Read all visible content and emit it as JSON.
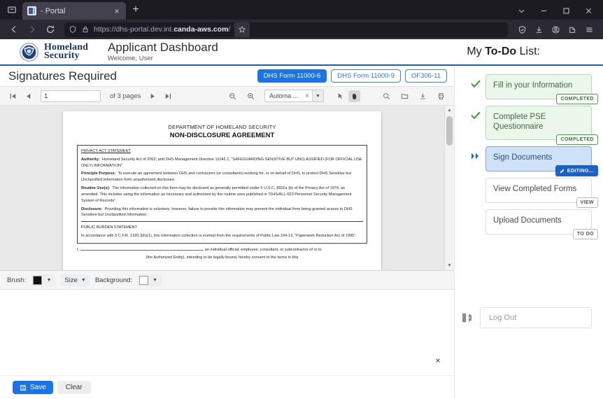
{
  "browser": {
    "tab_title": "- Portal",
    "url_display_prefix": "https://dhs-portal.dev.int.",
    "url_display_domain": "canda-aws.com",
    "url_display_suffix": "/",
    "new_tab_label": "+",
    "close_tab_label": "×"
  },
  "header": {
    "agency_line1": "Homeland",
    "agency_line2": "Security",
    "app_title": "Applicant Dashboard",
    "welcome": "Welcome, User",
    "todo_heading_pre": "My ",
    "todo_heading_bold": "To-Do",
    "todo_heading_post": " List:"
  },
  "signatures": {
    "title": "Signatures Required",
    "form_tabs": [
      {
        "label": "DHS Form 11000-6",
        "active": true
      },
      {
        "label": "DHS Form 11000-9",
        "active": false
      },
      {
        "label": "OF306-11",
        "active": false
      }
    ]
  },
  "pdf_toolbar": {
    "page_value": "1",
    "page_total_label": "of 3 pages",
    "zoom_value": "Automa ...",
    "zoom_clear": "×",
    "zoom_caret": "▼",
    "icons": {
      "first_page": "first-page-icon",
      "prev_page": "prev-page-icon",
      "next_page": "next-page-icon",
      "last_page": "last-page-icon",
      "zoom_out": "zoom-out-icon",
      "zoom_in": "zoom-in-icon",
      "select_tool": "cursor-select-icon",
      "pan_tool": "hand-pan-icon",
      "find": "search-icon",
      "open_file": "open-file-icon",
      "download": "download-icon",
      "print": "print-icon"
    }
  },
  "document": {
    "agency": "DEPARTMENT OF HOMELAND SECURITY",
    "title": "NON-DISCLOSURE AGREEMENT",
    "privacy_heading": "PRIVACY ACT STATEMENT",
    "authority_label": "Authority:",
    "authority_text": "Homeland Security Act of 2002; and DHS Management Directive 11042.1, “SAFEGUARDING SENSITIVE BUT UNCLASSIFIED (FOR OFFICIAL USE ONLY) INFORMATION”.",
    "principle_label": "Principle Purpose:",
    "principle_text": "To execute an agreement between DHS and contractors (or consultants) working for, or on behalf of DHS, to protect DHS Sensitive but Unclassified Information from unauthorized disclosure.",
    "routine_label": "Routine Use(s):",
    "routine_text": "The information collected on this form may be disclosed as generally permitted under 5 U.S.C. §552a (b) of the Privacy Act of 1974, as amended. This includes using the information as necessary and authorized by the routine uses published in “DHS/ALL-023 Personnel Security Management System of Records”.",
    "disclosure_label": "Disclosure:",
    "disclosure_text": "Providing this information is voluntary; however, failure to provide this information may prevent the individual from being granted access to DHS Sensitive but Unclassified Information.",
    "burden_heading": "PUBLIC BURDEN STATEMENT",
    "burden_text": "In accordance with 5 C.F.R. 1320.3(h)(1), this information collection is exempt from the requirements of Public Law 104-13, “Paperwork Reduction Act of 1995”.",
    "consent_start": "I,",
    "consent_mid": ", an individual official, employee, consultant, or subcontractor of or to",
    "consent_line2": "(the Authorized Entity), intending to be legally bound, hereby consent to the terms in this"
  },
  "signature_tools": {
    "brush_label": "Brush:",
    "brush_color": "#111111",
    "size_label": "Size",
    "background_label": "Background:",
    "background_color": "#ffffff",
    "caret": "▼",
    "close_canvas": "×",
    "save_label": "Save",
    "clear_label": "Clear"
  },
  "todo": {
    "items": [
      {
        "label": "Fill in your Information",
        "badge": "COMPLETED",
        "state": "done"
      },
      {
        "label": "Complete PSE Questionnaire",
        "badge": "COMPLETED",
        "state": "done"
      },
      {
        "label": "Sign Documents",
        "badge": "EDITING...",
        "state": "active"
      },
      {
        "label": "View Completed Forms",
        "badge": "VIEW",
        "state": "idle"
      },
      {
        "label": "Upload Documents",
        "badge": "TO DO",
        "state": "idle"
      }
    ],
    "logout_label": "Log Out"
  },
  "colors": {
    "accent_blue": "#1a73e8",
    "dhs_navy": "#17365d",
    "completed_green": "#2f7d2f",
    "active_blue_bg": "#cfe2f7"
  }
}
